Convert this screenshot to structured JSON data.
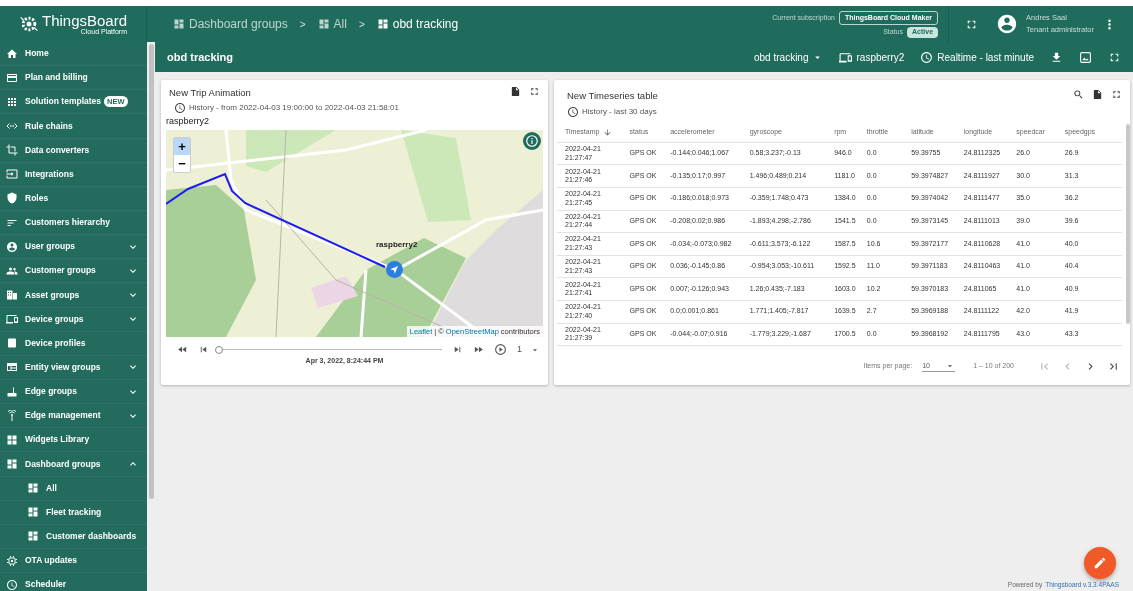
{
  "header": {
    "logo": {
      "title": "ThingsBoard",
      "subtitle": "Cloud Platform"
    },
    "breadcrumbs": [
      {
        "label": "Dashboard groups",
        "selected": false
      },
      {
        "label": "All",
        "selected": false
      },
      {
        "label": "obd tracking",
        "selected": true
      }
    ],
    "breadcrumb_separators": [
      ">",
      ">"
    ],
    "subscription": {
      "label": "Current subscription",
      "plan": "ThingsBoard Cloud Maker",
      "status_label": "Status",
      "status": "Active"
    },
    "user": {
      "name": "Andres Saal",
      "role": "Tenant administrator"
    }
  },
  "sidebar": {
    "items": [
      {
        "label": "Home"
      },
      {
        "label": "Plan and billing"
      },
      {
        "label": "Solution templates",
        "badge": "NEW"
      },
      {
        "label": "Rule chains"
      },
      {
        "label": "Data converters"
      },
      {
        "label": "Integrations"
      },
      {
        "label": "Roles"
      },
      {
        "label": "Customers hierarchy"
      },
      {
        "label": "User groups",
        "expanded": false
      },
      {
        "label": "Customer groups",
        "expanded": false
      },
      {
        "label": "Asset groups",
        "expanded": false
      },
      {
        "label": "Device groups",
        "expanded": false
      },
      {
        "label": "Device profiles"
      },
      {
        "label": "Entity view groups",
        "expanded": false
      },
      {
        "label": "Edge groups",
        "expanded": false
      },
      {
        "label": "Edge management",
        "expanded": false
      },
      {
        "label": "Widgets Library"
      },
      {
        "label": "Dashboard groups",
        "expanded": true,
        "children": [
          {
            "label": "All"
          },
          {
            "label": "Fleet tracking"
          },
          {
            "label": "Customer dashboards"
          }
        ]
      },
      {
        "label": "OTA updates"
      },
      {
        "label": "Scheduler"
      }
    ]
  },
  "dashboard_toolbar": {
    "title": "obd tracking",
    "state": "obd tracking",
    "entity": "raspberry2",
    "timewindow": "Realtime - last minute"
  },
  "trip_animation": {
    "title": "New Trip Animation",
    "timewindow": "History - from 2022-04-03 19:00:00 to 2022-04-03 21:58:01",
    "entity_label": "raspberry2",
    "marker_label": "raspberry2",
    "zoom_buttons": [
      "+",
      "−"
    ],
    "attribution": {
      "leaflet": "Leaflet",
      "separator": "| ©",
      "osm": "OpenStreetMap",
      "suffix": "contributors"
    },
    "timeline": {
      "level": 0,
      "time": "Apr 3, 2022, 8:24:44 PM",
      "speed": "1"
    }
  },
  "timeseries_table": {
    "title": "New Timeseries table",
    "timewindow": "History - last 30 days",
    "columns": [
      {
        "label": "Timestamp",
        "sorted": true
      },
      {
        "label": "status",
        "sorted": false
      },
      {
        "label": "accelerometer",
        "sorted": false
      },
      {
        "label": "gyroscope",
        "sorted": false
      },
      {
        "label": "rpm",
        "sorted": false
      },
      {
        "label": "throttle",
        "sorted": false
      },
      {
        "label": "latitude",
        "sorted": false
      },
      {
        "label": "longitude",
        "sorted": false
      },
      {
        "label": "speedcar",
        "sorted": false
      },
      {
        "label": "speedgps",
        "sorted": false
      }
    ],
    "rows": [
      [
        "2022-04-21 21:27:47",
        "GPS OK",
        "-0.144;0.046;1.067",
        "0.58;3.237;-0.13",
        "946.0",
        "0.0",
        "59.39755",
        "24.8112325",
        "26.0",
        "26.9"
      ],
      [
        "2022-04-21 21:27:46",
        "GPS OK",
        "-0.135;0.17;0.997",
        "1.496;0.489;0.214",
        "1181.0",
        "0.0",
        "59.3974827",
        "24.8111927",
        "30.0",
        "31.3"
      ],
      [
        "2022-04-21 21:27:45",
        "GPS OK",
        "-0.186;0.018;0.973",
        "-0.359;1.748;0.473",
        "1384.0",
        "0.0",
        "59.3974042",
        "24.8111477",
        "35.0",
        "36.2"
      ],
      [
        "2022-04-21 21:27:44",
        "GPS OK",
        "-0.208;0.02;0.986",
        "-1.893;4.298;-2.786",
        "1541.5",
        "0.0",
        "59.3973145",
        "24.8111013",
        "39.0",
        "39.6"
      ],
      [
        "2022-04-21 21:27:43",
        "GPS OK",
        "-0.034;-0.073;0.982",
        "-0.611;3.573;-6.122",
        "1587.5",
        "10.6",
        "59.3972177",
        "24.8110628",
        "41.0",
        "40.0"
      ],
      [
        "2022-04-21 21:27:43",
        "GPS OK",
        "0.036;-0.145;0.86",
        "-0.954;3.053;-10.611",
        "1592.5",
        "11.0",
        "59.3971183",
        "24.8110463",
        "41.0",
        "40.4"
      ],
      [
        "2022-04-21 21:27:41",
        "GPS OK",
        "0.007;-0.126;0.943",
        "1.26;0.435;-7.183",
        "1603.0",
        "10.2",
        "59.3970183",
        "24.811065",
        "41.0",
        "40.9"
      ],
      [
        "2022-04-21 21:27:40",
        "GPS OK",
        "0.0;0.001;0.861",
        "1.771;1.405;-7.817",
        "1639.5",
        "2.7",
        "59.3969188",
        "24.8111122",
        "42.0",
        "41.9"
      ],
      [
        "2022-04-21 21:27:39",
        "GPS OK",
        "-0.044;-0.07;0.916",
        "-1.779;3.229;-1.687",
        "1700.5",
        "0.0",
        "59.3968192",
        "24.8111795",
        "43.0",
        "43.3"
      ]
    ],
    "pagination": {
      "items_per_page_label": "Items per page:",
      "page_size": "10",
      "range": "1 – 10 of 200",
      "nav_buttons": [
        {
          "disabled": true
        },
        {
          "disabled": true
        },
        {
          "disabled": false
        },
        {
          "disabled": false
        }
      ]
    }
  },
  "footer": {
    "text": "Powered by",
    "link": "Thingsboard v.3.3.4PAAS"
  }
}
